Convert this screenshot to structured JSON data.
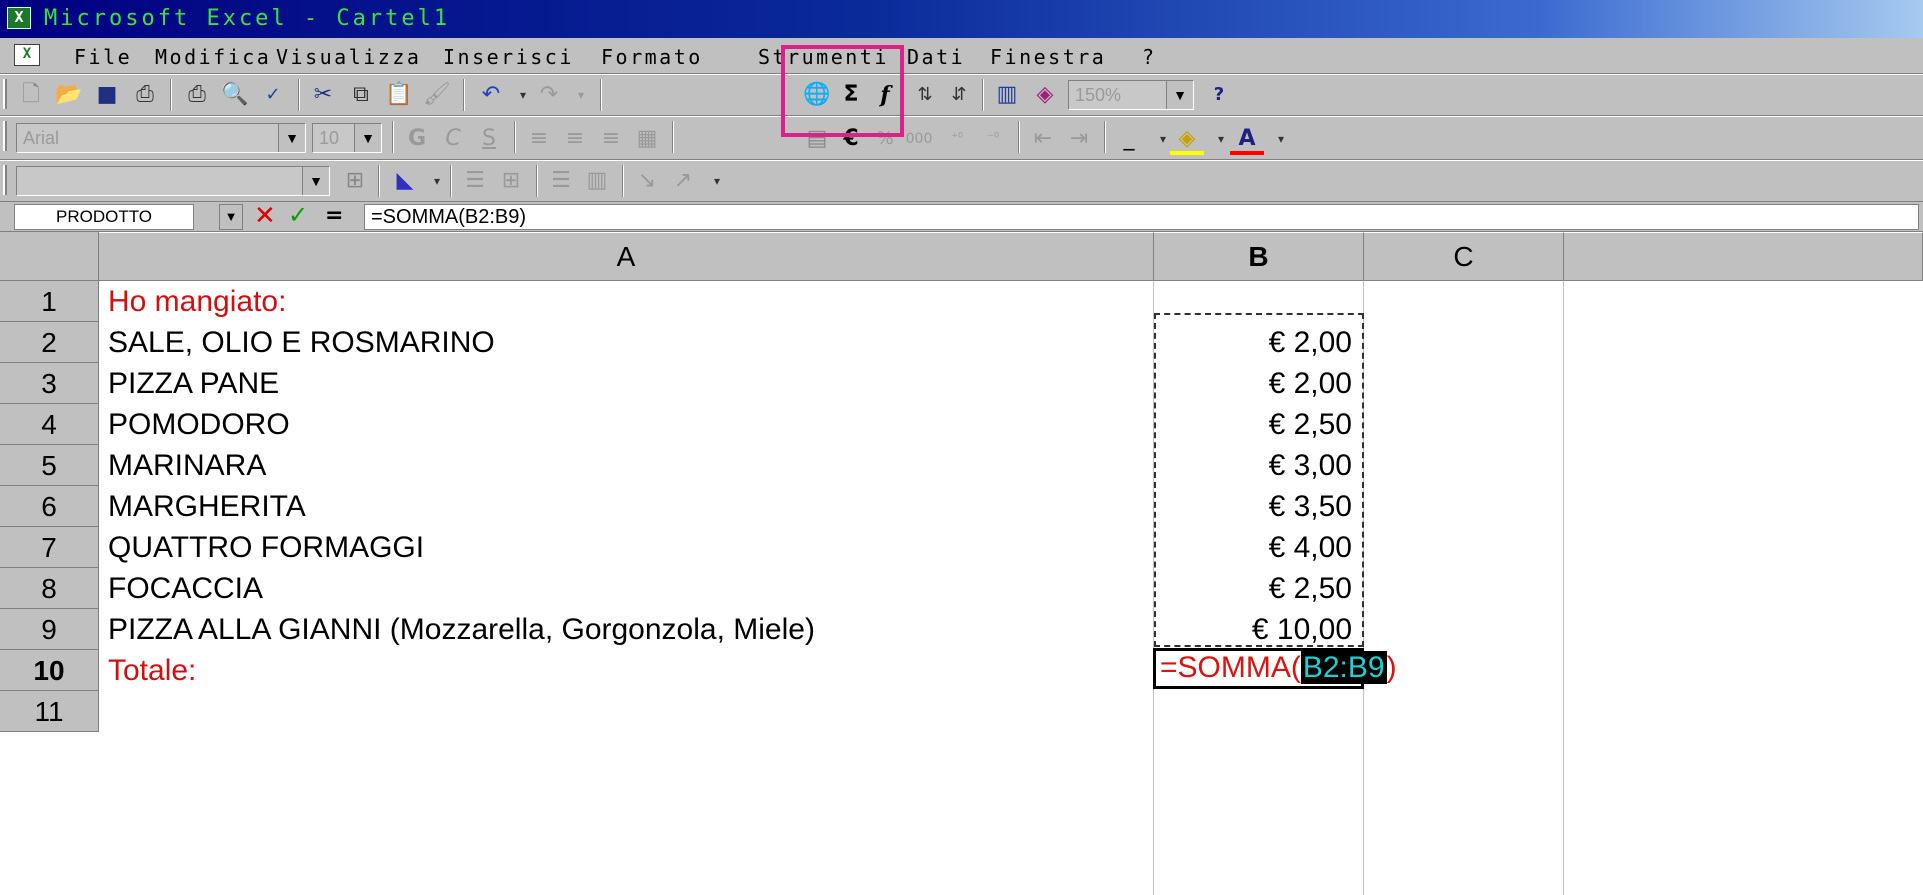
{
  "window": {
    "title": "Microsoft Excel - Cartel1"
  },
  "menu": [
    "File",
    "Modifica",
    "Visualizza",
    "Inserisci",
    "Formato",
    "Strumenti",
    "Dati",
    "Finestra",
    "?"
  ],
  "toolbar_format": {
    "font": "Arial",
    "size": "10"
  },
  "toolbar_standard": {
    "zoom": "150%"
  },
  "formula_bar": {
    "name_box": "PRODOTTO",
    "formula": "=SOMMA(B2:B9)"
  },
  "columns": [
    "A",
    "B",
    "C"
  ],
  "rows": [
    {
      "num": "1",
      "a": "Ho mangiato:",
      "b": ""
    },
    {
      "num": "2",
      "a": "SALE, OLIO E ROSMARINO",
      "b": "€ 2,00"
    },
    {
      "num": "3",
      "a": "PIZZA PANE",
      "b": "€ 2,00"
    },
    {
      "num": "4",
      "a": "POMODORO",
      "b": "€ 2,50"
    },
    {
      "num": "5",
      "a": "MARINARA",
      "b": "€ 3,00"
    },
    {
      "num": "6",
      "a": "MARGHERITA",
      "b": "€ 3,50"
    },
    {
      "num": "7",
      "a": "QUATTRO FORMAGGI",
      "b": "€ 4,00"
    },
    {
      "num": "8",
      "a": "FOCACCIA",
      "b": "€ 2,50"
    },
    {
      "num": "9",
      "a": "PIZZA ALLA GIANNI (Mozzarella, Gorgonzola, Miele)",
      "b": "€ 10,00"
    },
    {
      "num": "10",
      "a": "Totale:",
      "b": ""
    },
    {
      "num": "11",
      "a": "",
      "b": ""
    }
  ],
  "editing_cell": {
    "prefix": "=SOMMA(",
    "range": "B2:B9",
    "suffix": ")"
  },
  "colors": {
    "title_bar": "#000080",
    "highlight_box": "#e0208a",
    "red_text": "#d01010"
  }
}
